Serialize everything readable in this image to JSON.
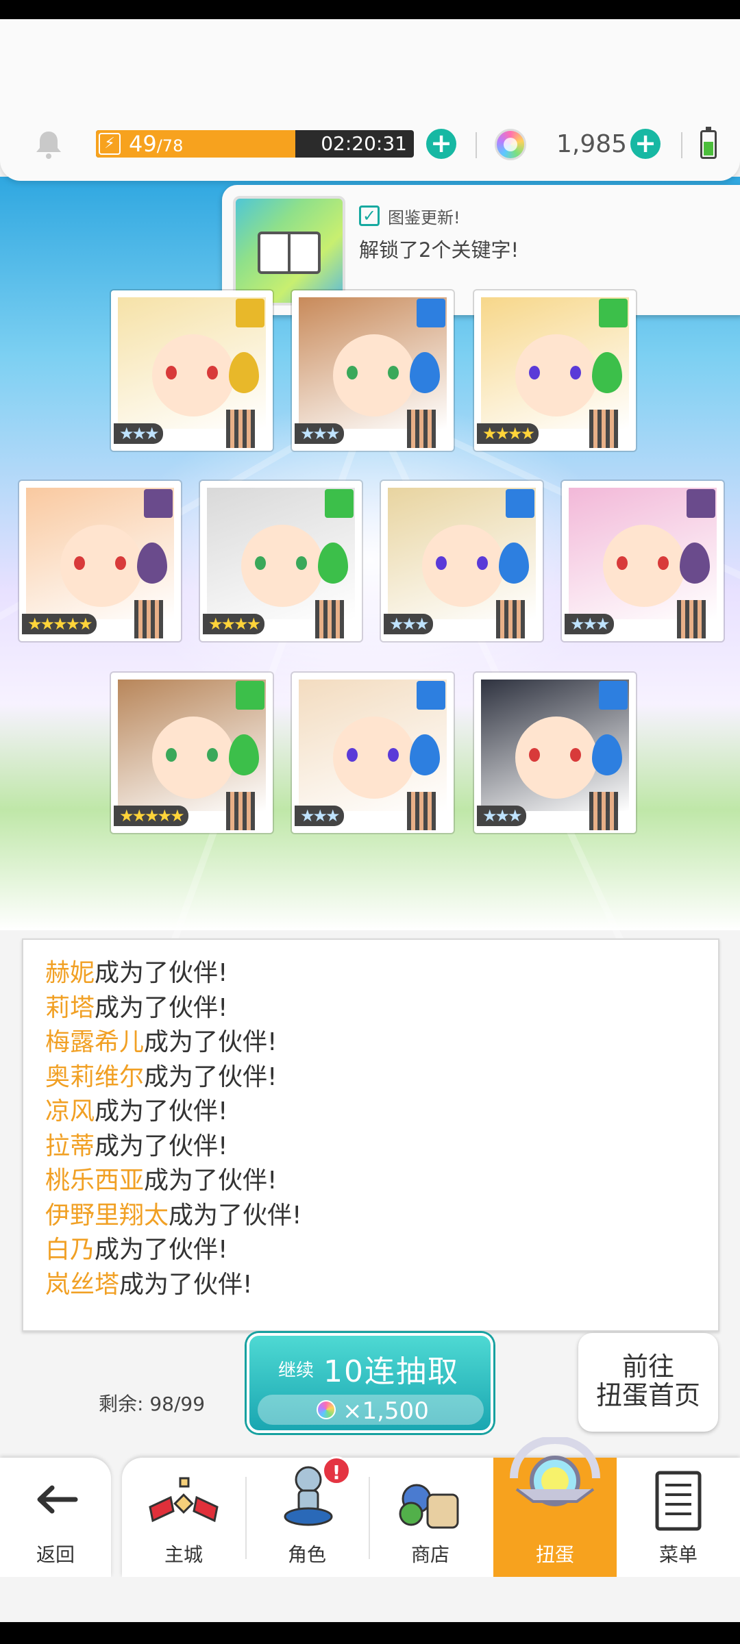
{
  "topbar": {
    "energy_current": "49",
    "energy_max": "/78",
    "energy_level": 0.628,
    "energy_timer": "02:20:31",
    "gem_count": "1,985"
  },
  "notice": {
    "title": "图鉴更新!",
    "text": "解锁了2个关键字!"
  },
  "cards": [
    {
      "stars": "★★★",
      "rarity": 3,
      "element": "yellow"
    },
    {
      "stars": "★★★",
      "rarity": 3,
      "element": "blue"
    },
    {
      "stars": "★★★★",
      "rarity": 4,
      "element": "green"
    },
    {
      "stars": "★★★★★",
      "rarity": 5,
      "element": "purple"
    },
    {
      "stars": "★★★★",
      "rarity": 4,
      "element": "green"
    },
    {
      "stars": "★★★",
      "rarity": 3,
      "element": "blue"
    },
    {
      "stars": "★★★",
      "rarity": 3,
      "element": "purple"
    },
    {
      "stars": "★★★★★",
      "rarity": 5,
      "element": "green"
    },
    {
      "stars": "★★★",
      "rarity": 3,
      "element": "blue"
    },
    {
      "stars": "★★★",
      "rarity": 3,
      "element": "blue"
    }
  ],
  "log": {
    "suffix": "成为了伙伴!",
    "names": [
      "赫妮",
      "莉塔",
      "梅露希儿",
      "奥莉维尔",
      "凉风",
      "拉蒂",
      "桃乐西亚",
      "伊野里翔太",
      "白乃",
      "岚丝塔"
    ]
  },
  "actions": {
    "remaining_label": "剩余: 98/99",
    "pull_prefix": "继续",
    "pull_title": "10连抽取",
    "pull_cost": "×1,500",
    "home_line1": "前往",
    "home_line2": "扭蛋首页"
  },
  "nav": {
    "back": "返回",
    "items": [
      {
        "label": "主城",
        "icon": "castle-icon"
      },
      {
        "label": "角色",
        "icon": "character-icon",
        "badge": "!"
      },
      {
        "label": "商店",
        "icon": "shop-icon"
      },
      {
        "label": "扭蛋",
        "icon": "gacha-icon",
        "active": true
      },
      {
        "label": "菜单",
        "icon": "menu-icon"
      }
    ]
  },
  "colors": {
    "accent": "#f7a21e",
    "teal": "#17b8a3",
    "name_orange": "#f1a024",
    "badge_red": "#e43442"
  }
}
